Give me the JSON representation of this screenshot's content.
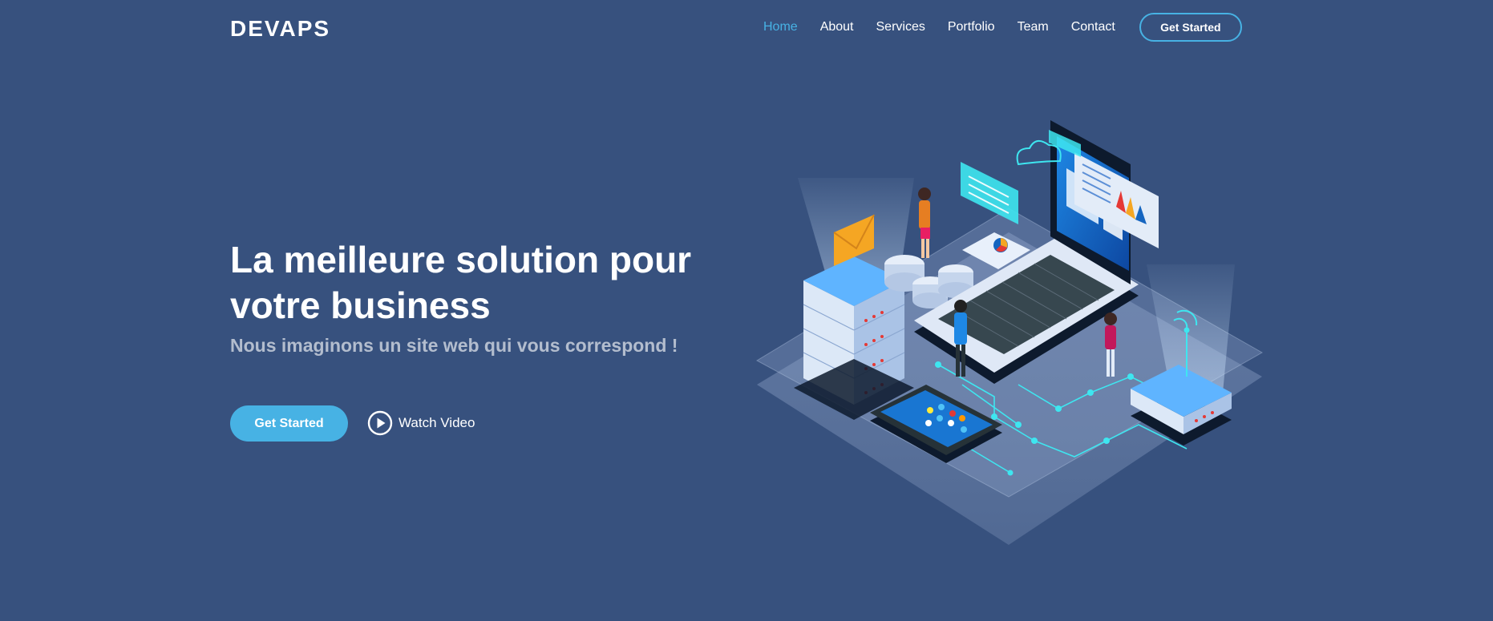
{
  "brand": {
    "logo_text": "DEVAPS"
  },
  "nav": {
    "items": [
      {
        "label": "Home",
        "active": true
      },
      {
        "label": "About",
        "active": false
      },
      {
        "label": "Services",
        "active": false
      },
      {
        "label": "Portfolio",
        "active": false
      },
      {
        "label": "Team",
        "active": false
      },
      {
        "label": "Contact",
        "active": false
      }
    ],
    "cta_label": "Get Started"
  },
  "hero": {
    "title": "La meilleure solution pour votre business",
    "subtitle": "Nous imaginons un site web qui vous correspond !",
    "primary_button_label": "Get Started",
    "video_link_label": "Watch Video"
  },
  "theme": {
    "background": "#37517e",
    "accent": "#47b2e4",
    "text": "#ffffff"
  },
  "icons": {
    "play": "play-circle-icon",
    "illustration": "isometric-tech-illustration"
  }
}
